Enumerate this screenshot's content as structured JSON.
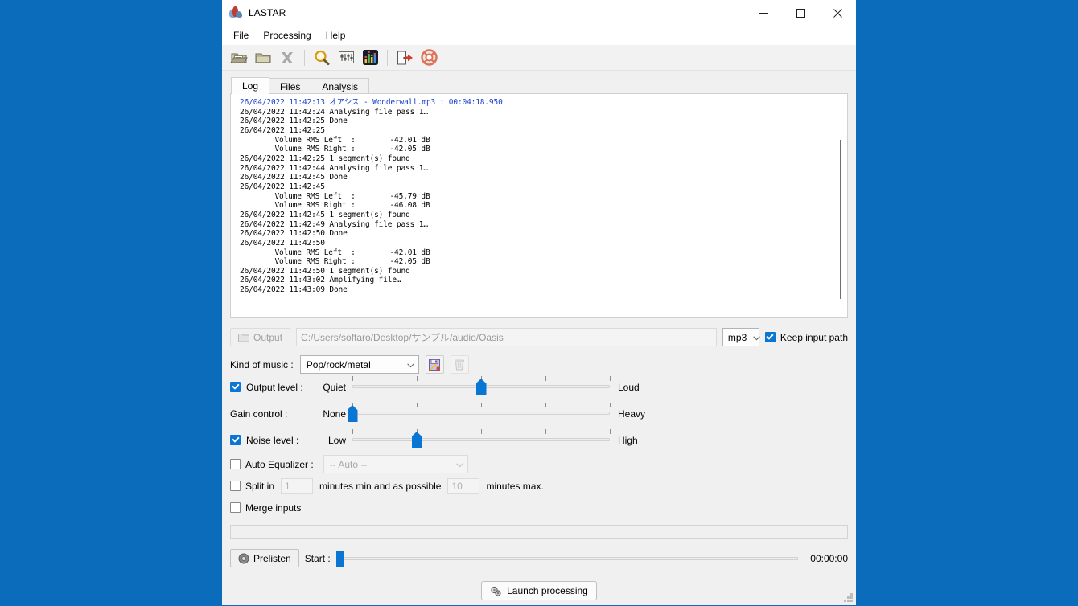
{
  "window": {
    "title": "LASTAR",
    "app_icon": "lastar-app-icon",
    "minimize": "─",
    "maximize": "□",
    "close": "✕"
  },
  "menubar": {
    "items": [
      {
        "label": "File",
        "name": "menu-file"
      },
      {
        "label": "Processing",
        "name": "menu-processing"
      },
      {
        "label": "Help",
        "name": "menu-help"
      }
    ]
  },
  "toolbar": {
    "buttons": [
      {
        "name": "open-file-icon",
        "title": "Open file"
      },
      {
        "name": "open-folder-icon",
        "title": "Open folder"
      },
      {
        "name": "clear-remove-icon",
        "title": "Remove"
      },
      {
        "name": "analyse-search-icon",
        "title": "Analyse"
      },
      {
        "name": "settings-sliders-icon",
        "title": "Settings"
      },
      {
        "name": "equalizer-icon",
        "title": "Equalizer"
      },
      {
        "name": "exit-door-icon",
        "title": "Exit"
      },
      {
        "name": "help-lifebuoy-icon",
        "title": "Help"
      }
    ]
  },
  "tabs": [
    {
      "label": "Log",
      "name": "tab-log",
      "active": true
    },
    {
      "label": "Files",
      "name": "tab-files",
      "active": false
    },
    {
      "label": "Analysis",
      "name": "tab-analysis",
      "active": false
    }
  ],
  "log": {
    "lines": [
      {
        "text": "26/04/2022 11:42:13 オアシス - Wonderwall.mp3 : 00:04:18.950",
        "highlight": true
      },
      {
        "text": "26/04/2022 11:42:24 Analysing file pass 1…",
        "highlight": false
      },
      {
        "text": "26/04/2022 11:42:25 Done",
        "highlight": false
      },
      {
        "text": "26/04/2022 11:42:25",
        "highlight": false
      },
      {
        "indent": true,
        "label": "Volume RMS Left  :",
        "value": "-42.01 dB",
        "highlight": false
      },
      {
        "indent": true,
        "label": "Volume RMS Right :",
        "value": "-42.05 dB",
        "highlight": false
      },
      {
        "text": "26/04/2022 11:42:25 1 segment(s) found",
        "highlight": false
      },
      {
        "text": "26/04/2022 11:42:44 Analysing file pass 1…",
        "highlight": false
      },
      {
        "text": "26/04/2022 11:42:45 Done",
        "highlight": false
      },
      {
        "text": "26/04/2022 11:42:45",
        "highlight": false
      },
      {
        "indent": true,
        "label": "Volume RMS Left  :",
        "value": "-45.79 dB",
        "highlight": false
      },
      {
        "indent": true,
        "label": "Volume RMS Right :",
        "value": "-46.08 dB",
        "highlight": false
      },
      {
        "text": "26/04/2022 11:42:45 1 segment(s) found",
        "highlight": false
      },
      {
        "text": "26/04/2022 11:42:49 Analysing file pass 1…",
        "highlight": false
      },
      {
        "text": "26/04/2022 11:42:50 Done",
        "highlight": false
      },
      {
        "text": "26/04/2022 11:42:50",
        "highlight": false
      },
      {
        "indent": true,
        "label": "Volume RMS Left  :",
        "value": "-42.01 dB",
        "highlight": false
      },
      {
        "indent": true,
        "label": "Volume RMS Right :",
        "value": "-42.05 dB",
        "highlight": false
      },
      {
        "text": "26/04/2022 11:42:50 1 segment(s) found",
        "highlight": false
      },
      {
        "text": "26/04/2022 11:43:02 Amplifying file…",
        "highlight": false
      },
      {
        "text": "26/04/2022 11:43:09 Done",
        "highlight": false
      }
    ]
  },
  "output": {
    "button_label": "Output",
    "path_value": "C:/Users/softaro/Desktop/サンプル/audio/Oasis",
    "format_value": "mp3",
    "keep_input_path_label": "Keep input path",
    "keep_input_path_checked": true
  },
  "music": {
    "label": "Kind of music :",
    "value": "Pop/rock/metal",
    "save_icon": "save-preset-icon",
    "delete_icon": "delete-preset-icon"
  },
  "sliders": [
    {
      "name": "output-level",
      "label": "Output level :",
      "checkbox": true,
      "checked": true,
      "min_label": "Quiet",
      "max_label": "Loud",
      "ticks": 5,
      "value_percent": 50
    },
    {
      "name": "gain-control",
      "label": "Gain control :",
      "checkbox": false,
      "checked": false,
      "min_label": "None",
      "max_label": "Heavy",
      "ticks": 5,
      "value_percent": 0
    },
    {
      "name": "noise-level",
      "label": "Noise level :",
      "checkbox": true,
      "checked": true,
      "min_label": "Low",
      "max_label": "High",
      "ticks": 5,
      "value_percent": 25
    }
  ],
  "options": {
    "auto_equalizer_label": "Auto Equalizer :",
    "auto_equalizer_checked": false,
    "auto_equalizer_value": "-- Auto --",
    "split_label": "Split in",
    "split_checked": false,
    "split_min_value": "1",
    "split_mid_text": "minutes min and as possible",
    "split_max_value": "10",
    "split_end_text": "minutes max.",
    "merge_label": "Merge inputs",
    "merge_checked": false
  },
  "playback": {
    "prelisten_label": "Prelisten",
    "start_label": "Start :",
    "start_value_percent": 0,
    "time_display": "00:00:00"
  },
  "launch": {
    "label": "Launch processing",
    "icon": "gears-icon"
  },
  "colors": {
    "accent": "#0a76d3",
    "desktop": "#0a6cba",
    "log_highlight": "#1a3fd0"
  }
}
